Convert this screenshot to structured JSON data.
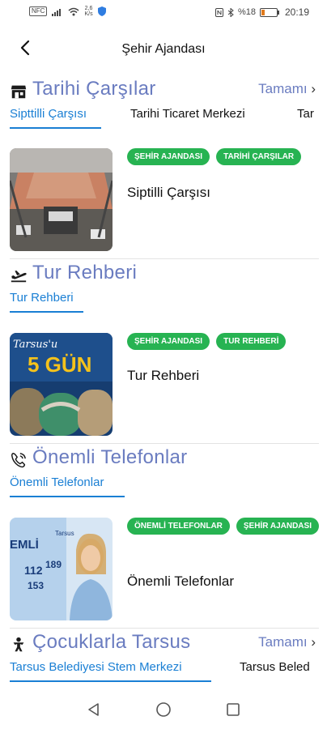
{
  "status_bar": {
    "left_badge": "NFC",
    "network_speed_value": "2,6",
    "network_speed_unit": "K/s",
    "battery": "%18",
    "time": "20:19"
  },
  "header": {
    "title": "Şehir Ajandası"
  },
  "sections": [
    {
      "name": "Tarihi Çarşılar",
      "more_label": "Tamamı",
      "tabs": [
        "Sipttilli Çarşısı",
        "Tarihi Ticaret Merkezi",
        "Tar"
      ],
      "card": {
        "badges": [
          "ŞEHİR AJANDASI",
          "TARİHİ ÇARŞILAR"
        ],
        "title": "Siptilli Çarşısı"
      }
    },
    {
      "name": "Tur Rehberi",
      "tabs": [
        "Tur Rehberi"
      ],
      "card": {
        "badges": [
          "ŞEHİR AJANDASI",
          "TUR REHBERİ"
        ],
        "title": "Tur Rehberi",
        "image_text_top": "Tarsus'u",
        "image_text_big": "5 GÜN"
      }
    },
    {
      "name": "Önemli Telefonlar",
      "tabs": [
        "Önemli Telefonlar"
      ],
      "card": {
        "badges": [
          "ÖNEMLİ TELEFONLAR",
          "ŞEHİR AJANDASI"
        ],
        "title": "Önemli Telefonlar",
        "image_text_word": "EMLİ",
        "image_text_numbers": [
          "112",
          "189",
          "153"
        ],
        "image_text_logo": "Tarsus"
      }
    },
    {
      "name": "Çocuklarla Tarsus",
      "more_label": "Tamamı",
      "tabs": [
        "Tarsus Belediyesi Stem Merkezi",
        "Tarsus Beled"
      ]
    }
  ],
  "icons": {
    "back": "arrow-back-icon",
    "more": "chevron-right-icon",
    "section_0": "store-icon",
    "section_1": "airplane-takeoff-icon",
    "section_2": "phone-call-icon",
    "section_3": "child-icon"
  },
  "colors": {
    "accent": "#6a7cc0",
    "tab_active": "#1a7fd4",
    "badge": "#27b352"
  }
}
